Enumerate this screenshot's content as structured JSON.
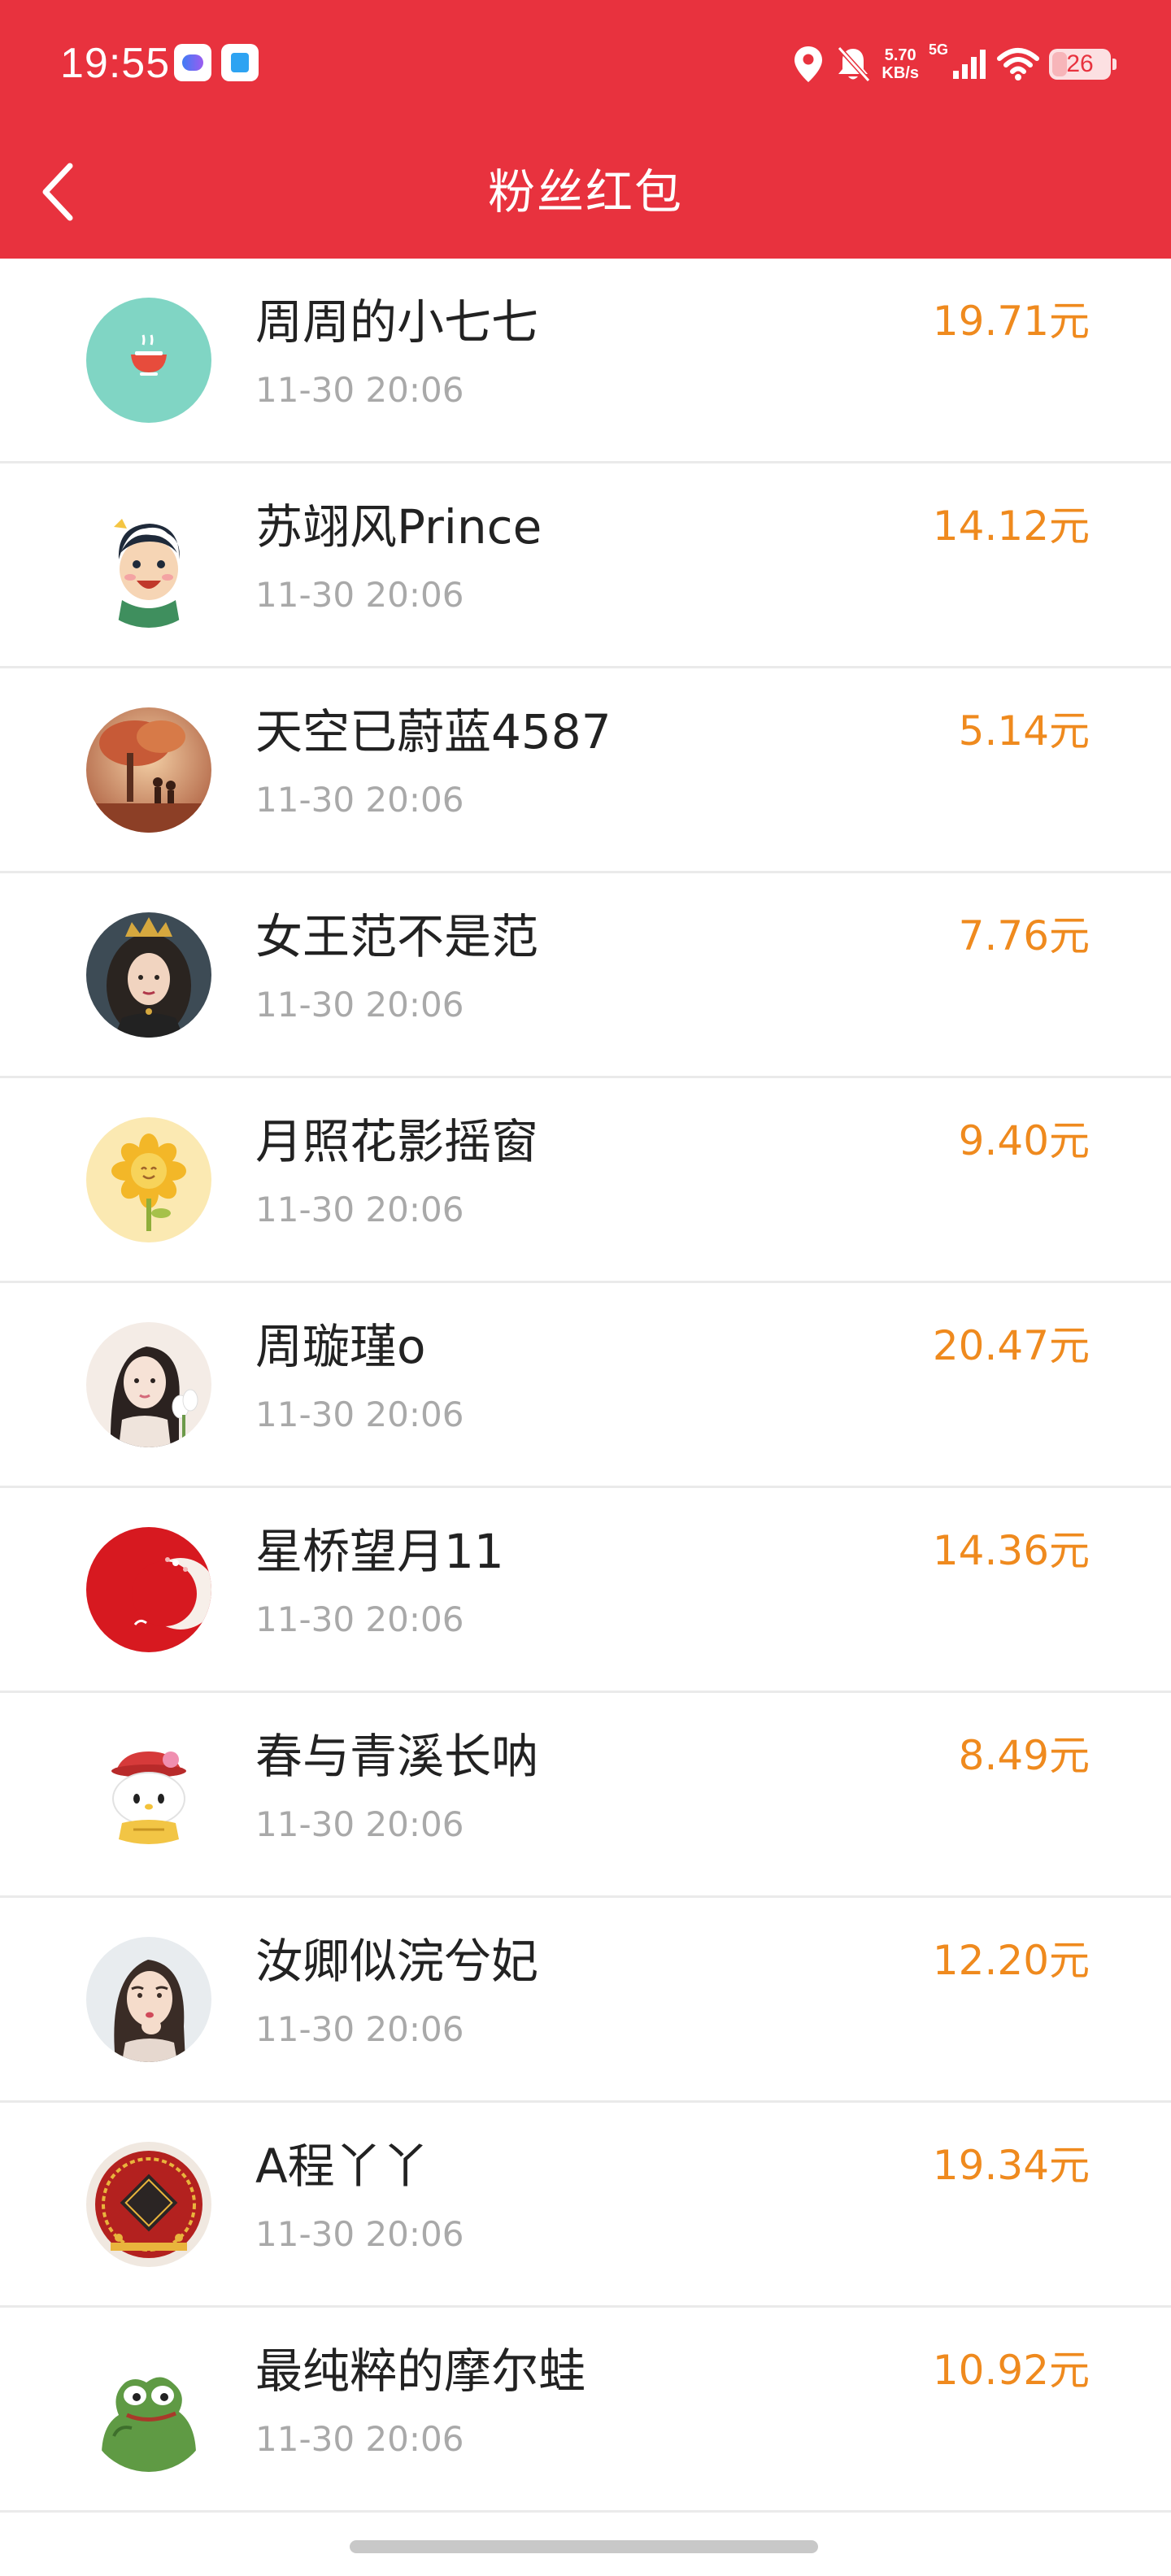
{
  "status_bar": {
    "time": "19:55",
    "net_speed_value": "5.70",
    "net_speed_unit": "KB/s",
    "signal_type": "5G",
    "battery": "26",
    "battery_fraction": 0.26,
    "icons": [
      "location-icon",
      "bell-muted-icon",
      "signal-icon",
      "wifi-icon",
      "battery-icon"
    ]
  },
  "header": {
    "title": "粉丝红包",
    "back_icon": "chevron-left-icon",
    "background_color": "#e8323e"
  },
  "colors": {
    "amount": "#ef8a1e",
    "name": "#222222",
    "time": "#a9a9a9",
    "divider": "#eaeaea"
  },
  "items": [
    {
      "name": "周周的小七七",
      "time": "11-30 20:06",
      "amount": "19.71元",
      "avatar": "teacup-avatar"
    },
    {
      "name": "苏翊风Prince",
      "time": "11-30 20:06",
      "amount": "14.12元",
      "avatar": "cartoon-boy-avatar"
    },
    {
      "name": "天空已蔚蓝4587",
      "time": "11-30 20:06",
      "amount": "5.14元",
      "avatar": "autumn-tree-avatar"
    },
    {
      "name": "女王范不是范",
      "time": "11-30 20:06",
      "amount": "7.76元",
      "avatar": "queen-avatar"
    },
    {
      "name": "月照花影摇窗",
      "time": "11-30 20:06",
      "amount": "9.40元",
      "avatar": "sunflower-avatar"
    },
    {
      "name": "周璇瑾o",
      "time": "11-30 20:06",
      "amount": "20.47元",
      "avatar": "girl-with-flowers-avatar"
    },
    {
      "name": "星桥望月11",
      "time": "11-30 20:06",
      "amount": "14.36元",
      "avatar": "red-moon-avatar"
    },
    {
      "name": "春与青溪长呐",
      "time": "11-30 20:06",
      "amount": "8.49元",
      "avatar": "hello-kitty-avatar"
    },
    {
      "name": "汝卿似浣兮妃",
      "time": "11-30 20:06",
      "amount": "12.20元",
      "avatar": "girl-portrait-avatar"
    },
    {
      "name": "A程丫丫",
      "time": "11-30 20:06",
      "amount": "19.34元",
      "avatar": "family-emblem-avatar"
    },
    {
      "name": "最纯粹的摩尔蛙",
      "time": "11-30 20:06",
      "amount": "10.92元",
      "avatar": "pepe-frog-avatar"
    }
  ]
}
